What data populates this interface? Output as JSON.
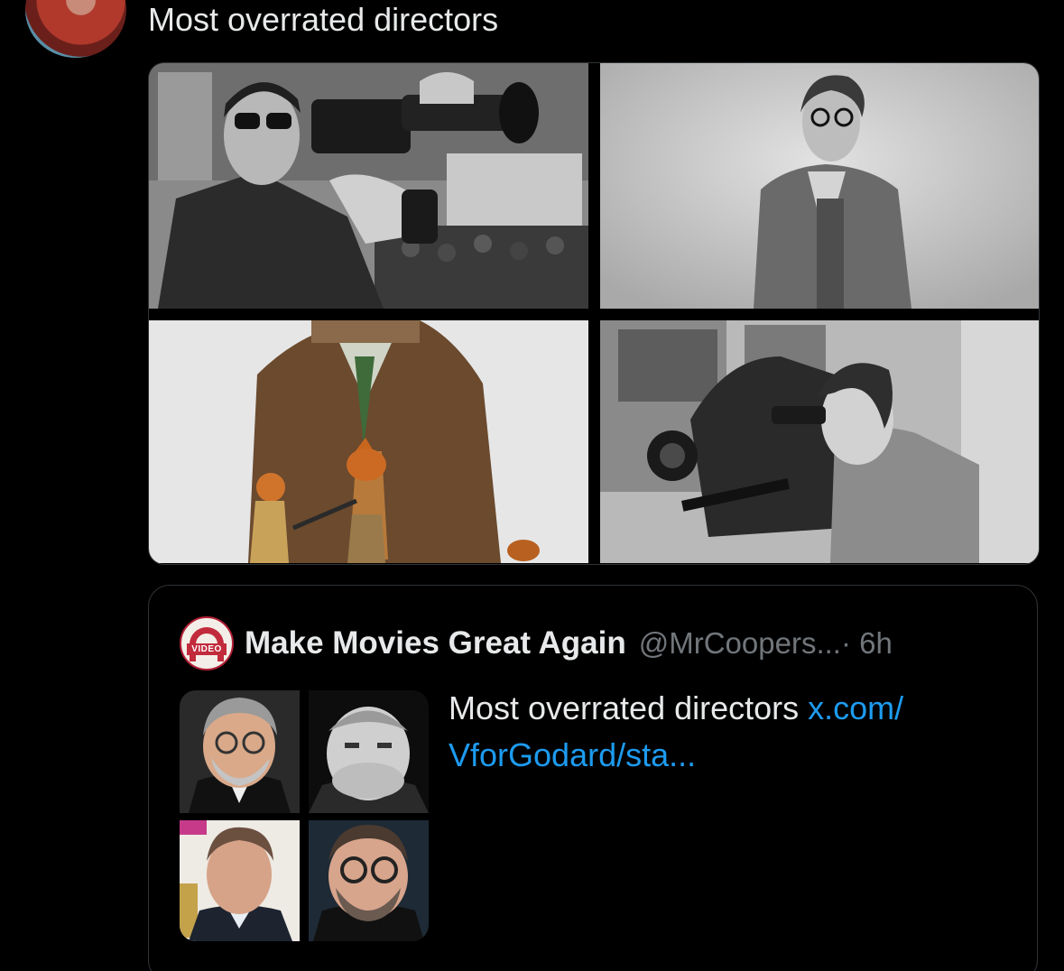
{
  "tweet": {
    "text": "Most overrated directors",
    "media": [
      {
        "name": "director-with-film-camera-photo"
      },
      {
        "name": "director-portrait-photo"
      },
      {
        "name": "director-with-fox-figures-photo"
      },
      {
        "name": "director-behind-camera-photo"
      }
    ]
  },
  "quote": {
    "author_name": "Make Movies Great Again",
    "handle": "@MrCoopers...",
    "time": "· 6h",
    "text": "Most overrated directors ",
    "link_text": "x.com/​VforGodard/sta...",
    "avatar_text": "VIDEO"
  },
  "colors": {
    "background": "#000000",
    "text": "#e7e9ea",
    "muted": "#71767b",
    "link": "#1d9bf0",
    "border": "#2f3336"
  }
}
